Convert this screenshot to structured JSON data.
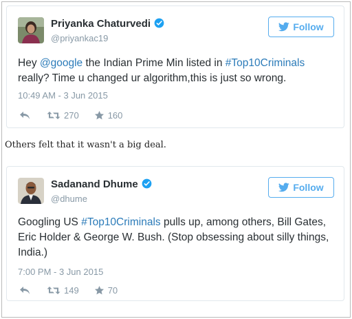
{
  "tweets": [
    {
      "name": "Priyanka Chaturvedi",
      "handle": "@priyankac19",
      "follow_label": "Follow",
      "text": {
        "p1": "Hey ",
        "mention": "@google",
        "p2": " the Indian Prime Min listed in ",
        "hashtag": "#Top10Criminals",
        "p3": " really? Time u changed ur algorithm,this is just so wrong."
      },
      "timestamp": "10:49 AM - 3 Jun 2015",
      "retweets": "270",
      "favorites": "160"
    },
    {
      "name": "Sadanand Dhume",
      "handle": "@dhume",
      "follow_label": "Follow",
      "text": {
        "p1": "Googling US ",
        "hashtag": "#Top10Criminals",
        "p2": " pulls up, among others, Bill Gates, Eric Holder & George W. Bush. (Stop obsessing about silly things, India.)"
      },
      "timestamp": "7:00 PM - 3 Jun 2015",
      "retweets": "149",
      "favorites": "70"
    }
  ],
  "between_text": "Others felt that it wasn't a big deal.",
  "colors": {
    "link": "#2b7bb9",
    "follow": "#55acee",
    "meta": "#8899a6",
    "text": "#292f33"
  },
  "icons": [
    "verified-badge-icon",
    "twitter-bird-icon",
    "reply-icon",
    "retweet-icon",
    "favorite-star-icon"
  ]
}
